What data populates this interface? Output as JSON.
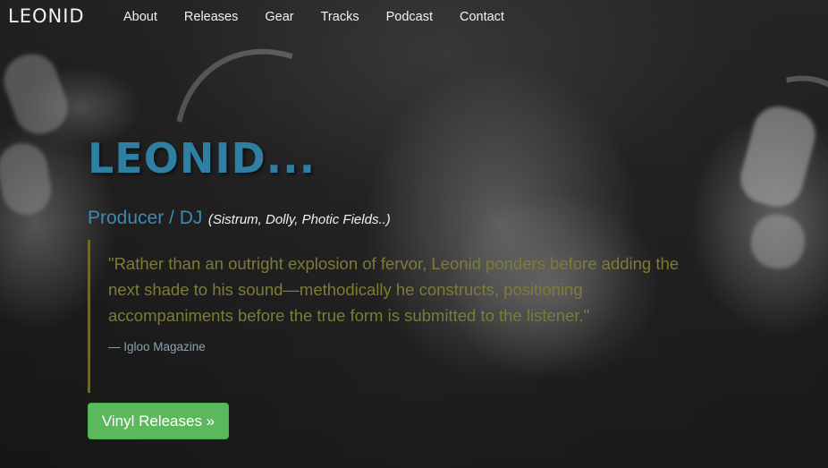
{
  "navbar": {
    "brand": "LEONID",
    "links": [
      "About",
      "Releases",
      "Gear",
      "Tracks",
      "Podcast",
      "Contact"
    ]
  },
  "hero": {
    "title": "LEONID...",
    "role": "Producer / DJ",
    "aliases": "(Sistrum, Dolly, Photic Fields..)",
    "quote": "\"Rather than an outright explosion of fervor, Leonid ponders before adding the next shade to his sound—methodically he constructs, positioning accompaniments before the true form is submitted to the listener.\"",
    "citation": "— Igloo Magazine",
    "button_label": "Vinyl Releases »"
  },
  "colors": {
    "title": "#2f7fa2",
    "quote_text": "#7d7c35",
    "button": "#5cb85c"
  }
}
